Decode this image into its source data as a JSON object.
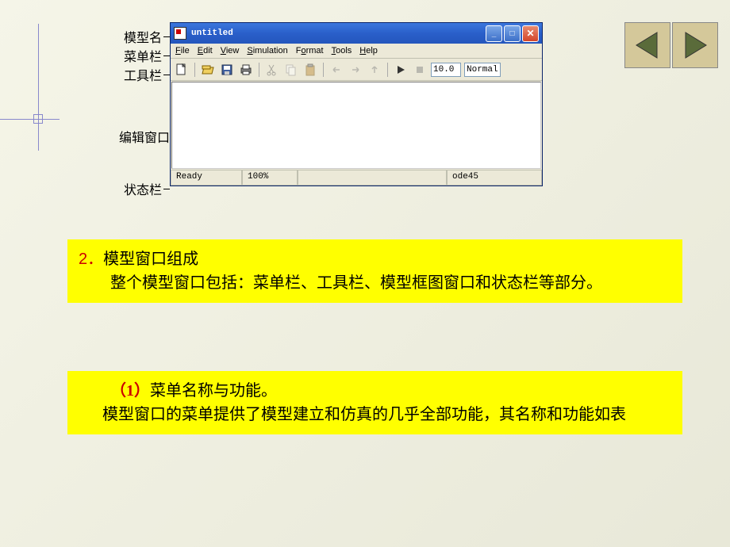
{
  "labels": {
    "model_name": "模型名",
    "menu_bar": "菜单栏",
    "tool_bar": "工具栏",
    "edit_window": "编辑窗口",
    "status_bar": "状态栏"
  },
  "window": {
    "title": "untitled",
    "menu": {
      "file": "File",
      "edit": "Edit",
      "view": "View",
      "simulation": "Simulation",
      "format": "Format",
      "tools": "Tools",
      "help": "Help"
    },
    "toolbar": {
      "time_value": "10.0",
      "mode": "Normal"
    },
    "status": {
      "ready": "Ready",
      "zoom": "100%",
      "solver": "ode45"
    }
  },
  "text1": {
    "num": "2．",
    "title": "模型窗口组成",
    "body": "整个模型窗口包括：菜单栏、工具栏、模型框图窗口和状态栏等部分。"
  },
  "text2": {
    "paren": "（1）",
    "title": "菜单名称与功能。",
    "body": "模型窗口的菜单提供了模型建立和仿真的几乎全部功能，其名称和功能如表"
  }
}
